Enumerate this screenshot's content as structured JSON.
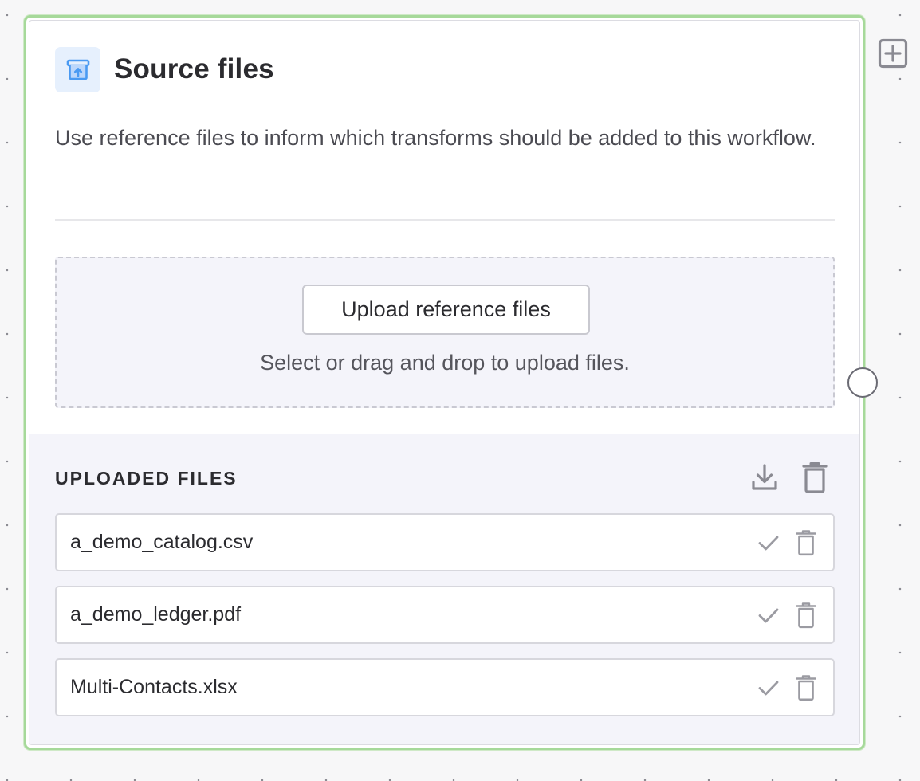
{
  "node": {
    "title": "Source files",
    "icon": "archive-upload-icon",
    "description": "Use reference files to inform which transforms should be added to this workflow.",
    "upload": {
      "button_label": "Upload reference files",
      "hint": "Select or drag and drop to upload files."
    },
    "uploaded": {
      "header": "UPLOADED FILES",
      "bulk_actions": [
        "download-icon",
        "trash-icon"
      ],
      "files": [
        {
          "name": "a_demo_catalog.csv",
          "status_icon": "check-icon"
        },
        {
          "name": "a_demo_ledger.pdf",
          "status_icon": "check-icon"
        },
        {
          "name": "Multi-Contacts.xlsx",
          "status_icon": "check-icon"
        }
      ]
    }
  },
  "canvas": {
    "add_icon": "plus-square-icon"
  },
  "colors": {
    "node_border_selected": "#a6d99a",
    "icon_tile_bg": "#e6f0fd",
    "icon_accent": "#4a9af2",
    "panel_bg": "#f4f4fa",
    "canvas_bg": "#f7f7f8"
  }
}
